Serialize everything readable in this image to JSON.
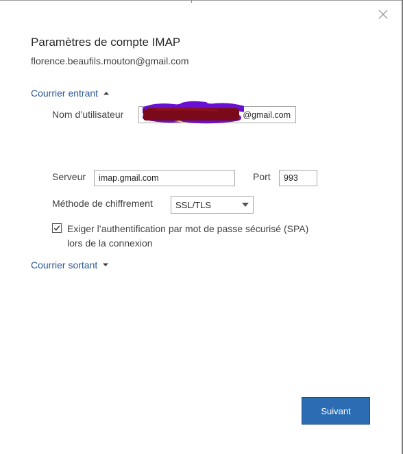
{
  "dialog": {
    "title": "Paramètres de compte IMAP",
    "account_email": "florence.beaufils.mouton@gmail.com",
    "close_icon": "close-icon"
  },
  "incoming": {
    "section_label": "Courrier entrant",
    "expanded": true,
    "chevron_icon": "chevron-up-icon",
    "username_label": "Nom d’utilisateur",
    "username_value": "@gmail.com",
    "username_redacted": true,
    "server_label": "Serveur",
    "server_value": "imap.gmail.com",
    "port_label": "Port",
    "port_value": "993",
    "encryption_label": "Méthode de chiffrement",
    "encryption_value": "SSL/TLS",
    "spa_checked": true,
    "spa_label_line1": "Exiger l’authentification par mot de passe sécurisé (SPA)",
    "spa_label_line2": "lors de la connexion"
  },
  "outgoing": {
    "section_label": "Courrier sortant",
    "expanded": false,
    "chevron_icon": "chevron-down-icon"
  },
  "footer": {
    "next_label": "Suivant"
  },
  "colors": {
    "accent": "#2b6cb3",
    "link": "#2b5797",
    "redaction_dark": "#7a0a1a",
    "redaction_purple": "#6a10d0"
  }
}
